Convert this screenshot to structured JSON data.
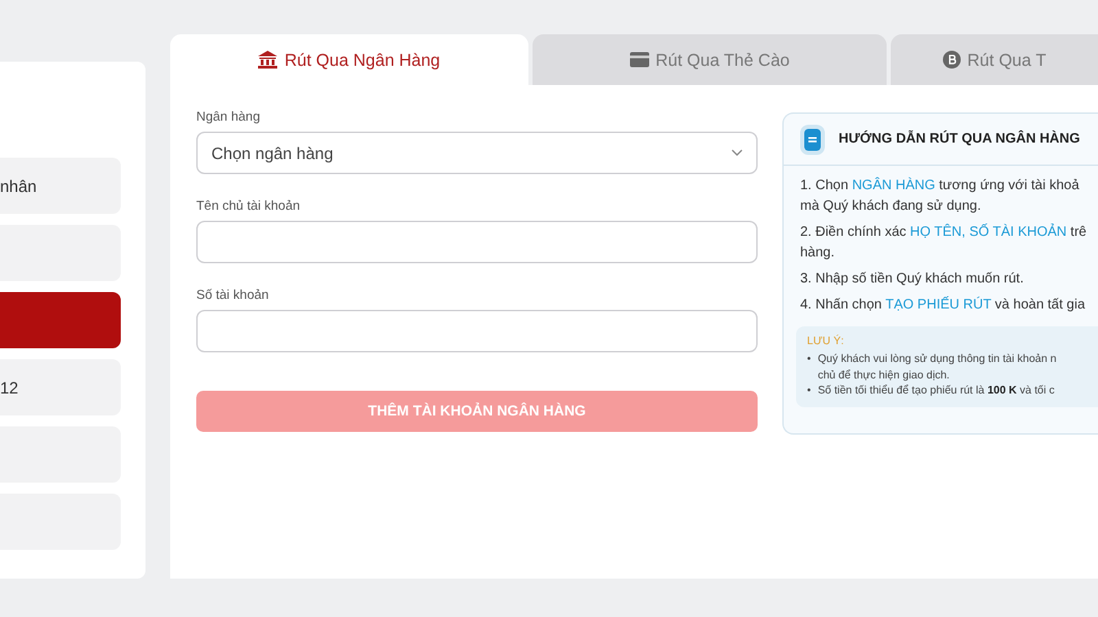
{
  "sidebar": {
    "items": [
      {
        "label": "nhân",
        "selected": false
      },
      {
        "selected": false
      },
      {
        "selected": true
      },
      {
        "label": "12",
        "selected": false
      },
      {
        "selected": false
      },
      {
        "selected": false
      }
    ]
  },
  "tabs": [
    {
      "label": "Rút Qua Ngân Hàng",
      "kind": "bank",
      "selected": true
    },
    {
      "label": "Rút Qua Thẻ Cào",
      "kind": "card",
      "selected": false
    },
    {
      "label": "Rút Qua T",
      "kind": "coin",
      "selected": false
    }
  ],
  "form": {
    "fields": [
      {
        "label": "Ngân hàng",
        "kind": "select",
        "placeholder": "Chọn ngân hàng"
      },
      {
        "label": "Tên chủ tài khoản",
        "kind": "text"
      },
      {
        "label": "Số tài khoản",
        "kind": "text"
      }
    ],
    "submit_button": {
      "label": "THÊM TÀI KHOẢN NGÂN HÀNG",
      "disabled": true
    }
  },
  "guide": {
    "title": "HƯỚNG DẪN RÚT QUA NGÂN HÀNG",
    "steps": [
      {
        "lines": [
          "1. Chọn **NGÂN HÀNG** tương ứng với tài khoả",
          "mà Quý khách đang sử dụng."
        ]
      },
      {
        "lines": [
          "2. Điền chính xác **HỌ TÊN, SỐ TÀI KHOẢN** trê",
          "hàng."
        ]
      },
      {
        "lines": [
          "3. Nhập số tiền Quý khách muốn rút."
        ]
      },
      {
        "lines": [
          "4. Nhấn chọn **TẠO PHIẾU RÚT** và hoàn tất gia"
        ]
      }
    ],
    "note": {
      "title": "LƯU Ý:",
      "bullets": [
        {
          "mark": "•",
          "lines": [
            "Quý khách vui lòng sử dụng thông tin tài khoản n",
            "chủ để thực hiện giao dịch."
          ]
        },
        {
          "mark": "•",
          "lines": [
            "Số tiền tối thiểu để tạo phiếu rút là **100 K** và tối c"
          ]
        }
      ]
    }
  }
}
